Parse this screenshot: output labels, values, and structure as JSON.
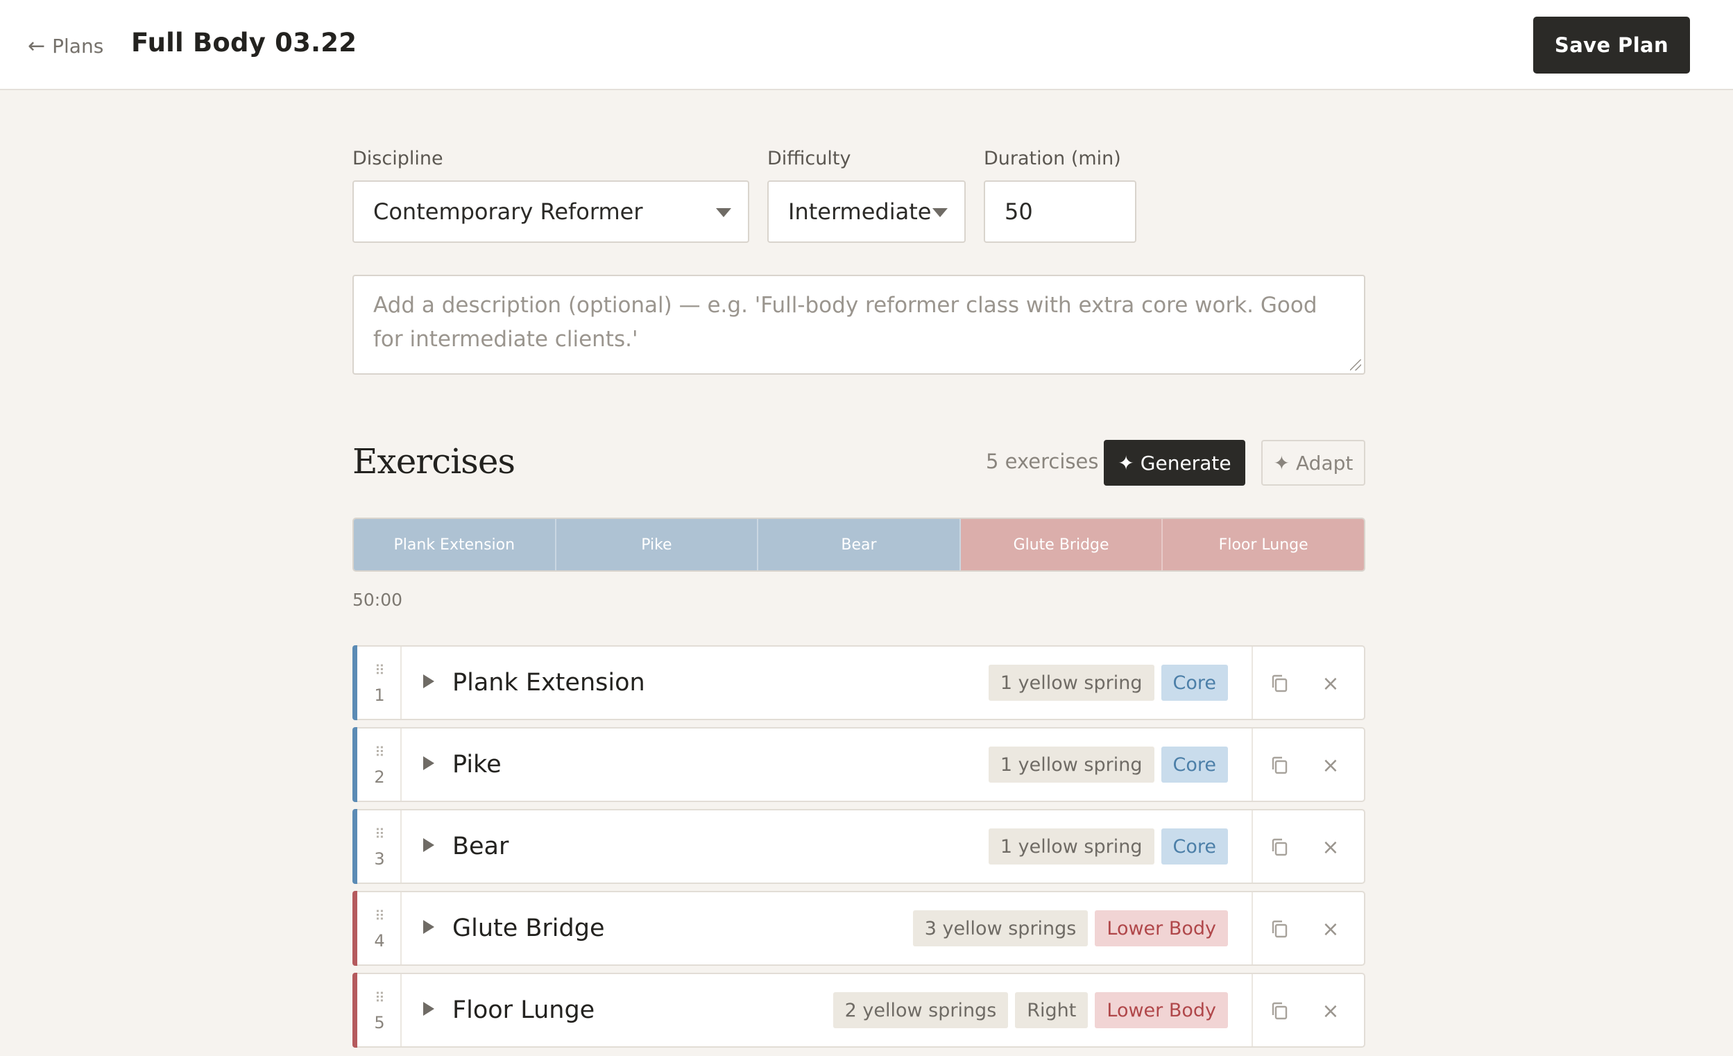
{
  "header": {
    "back_arrow": "←",
    "back_label": "Plans",
    "title": "Full Body 03.22",
    "save_label": "Save Plan"
  },
  "form": {
    "discipline": {
      "label": "Discipline",
      "value": "Contemporary Reformer"
    },
    "difficulty": {
      "label": "Difficulty",
      "value": "Intermediate"
    },
    "duration": {
      "label": "Duration (min)",
      "value": "50"
    },
    "description_placeholder": "Add a description (optional) — e.g. 'Full-body reformer class with extra core work. Good for intermediate clients.'"
  },
  "exercises_section": {
    "title": "Exercises",
    "count": "5 exercises",
    "generate_label": "✦ Generate",
    "adapt_label": "✦ Adapt"
  },
  "timeline": {
    "segments": [
      {
        "label": "Plank Extension",
        "color": "#aec2d3"
      },
      {
        "label": "Pike",
        "color": "#aec2d3"
      },
      {
        "label": "Bear",
        "color": "#aec2d3"
      },
      {
        "label": "Glute Bridge",
        "color": "#dbaeab"
      },
      {
        "label": "Floor Lunge",
        "color": "#dbaeab"
      }
    ],
    "total": "50:00"
  },
  "colors": {
    "core_accent": "#5b8bb5",
    "lower_accent": "#b55a5d"
  },
  "exercises": [
    {
      "number": "1",
      "name": "Plank Extension",
      "tags": [
        "1 yellow spring",
        "Core"
      ]
    },
    {
      "number": "2",
      "name": "Pike",
      "tags": [
        "1 yellow spring",
        "Core"
      ]
    },
    {
      "number": "3",
      "name": "Bear",
      "tags": [
        "1 yellow spring",
        "Core"
      ]
    },
    {
      "number": "4",
      "name": "Glute Bridge",
      "tags": [
        "3 yellow springs",
        "Lower Body"
      ]
    },
    {
      "number": "5",
      "name": "Floor Lunge",
      "tags": [
        "2 yellow springs",
        "Right",
        "Lower Body"
      ]
    }
  ],
  "icons": {
    "drag": "drag-handle-icon",
    "expand": "play-triangle-icon",
    "duplicate": "copy-icon",
    "remove": "close-icon",
    "remove_glyph": "×",
    "drag_glyph": "⠿"
  }
}
